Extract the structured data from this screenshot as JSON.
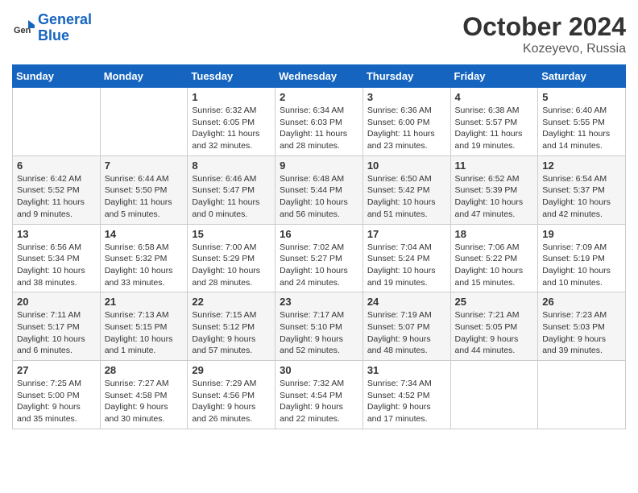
{
  "logo": {
    "line1": "General",
    "line2": "Blue"
  },
  "title": "October 2024",
  "location": "Kozeyevo, Russia",
  "days_of_week": [
    "Sunday",
    "Monday",
    "Tuesday",
    "Wednesday",
    "Thursday",
    "Friday",
    "Saturday"
  ],
  "weeks": [
    [
      {
        "day": "",
        "info": ""
      },
      {
        "day": "",
        "info": ""
      },
      {
        "day": "1",
        "info": "Sunrise: 6:32 AM\nSunset: 6:05 PM\nDaylight: 11 hours and 32 minutes."
      },
      {
        "day": "2",
        "info": "Sunrise: 6:34 AM\nSunset: 6:03 PM\nDaylight: 11 hours and 28 minutes."
      },
      {
        "day": "3",
        "info": "Sunrise: 6:36 AM\nSunset: 6:00 PM\nDaylight: 11 hours and 23 minutes."
      },
      {
        "day": "4",
        "info": "Sunrise: 6:38 AM\nSunset: 5:57 PM\nDaylight: 11 hours and 19 minutes."
      },
      {
        "day": "5",
        "info": "Sunrise: 6:40 AM\nSunset: 5:55 PM\nDaylight: 11 hours and 14 minutes."
      }
    ],
    [
      {
        "day": "6",
        "info": "Sunrise: 6:42 AM\nSunset: 5:52 PM\nDaylight: 11 hours and 9 minutes."
      },
      {
        "day": "7",
        "info": "Sunrise: 6:44 AM\nSunset: 5:50 PM\nDaylight: 11 hours and 5 minutes."
      },
      {
        "day": "8",
        "info": "Sunrise: 6:46 AM\nSunset: 5:47 PM\nDaylight: 11 hours and 0 minutes."
      },
      {
        "day": "9",
        "info": "Sunrise: 6:48 AM\nSunset: 5:44 PM\nDaylight: 10 hours and 56 minutes."
      },
      {
        "day": "10",
        "info": "Sunrise: 6:50 AM\nSunset: 5:42 PM\nDaylight: 10 hours and 51 minutes."
      },
      {
        "day": "11",
        "info": "Sunrise: 6:52 AM\nSunset: 5:39 PM\nDaylight: 10 hours and 47 minutes."
      },
      {
        "day": "12",
        "info": "Sunrise: 6:54 AM\nSunset: 5:37 PM\nDaylight: 10 hours and 42 minutes."
      }
    ],
    [
      {
        "day": "13",
        "info": "Sunrise: 6:56 AM\nSunset: 5:34 PM\nDaylight: 10 hours and 38 minutes."
      },
      {
        "day": "14",
        "info": "Sunrise: 6:58 AM\nSunset: 5:32 PM\nDaylight: 10 hours and 33 minutes."
      },
      {
        "day": "15",
        "info": "Sunrise: 7:00 AM\nSunset: 5:29 PM\nDaylight: 10 hours and 28 minutes."
      },
      {
        "day": "16",
        "info": "Sunrise: 7:02 AM\nSunset: 5:27 PM\nDaylight: 10 hours and 24 minutes."
      },
      {
        "day": "17",
        "info": "Sunrise: 7:04 AM\nSunset: 5:24 PM\nDaylight: 10 hours and 19 minutes."
      },
      {
        "day": "18",
        "info": "Sunrise: 7:06 AM\nSunset: 5:22 PM\nDaylight: 10 hours and 15 minutes."
      },
      {
        "day": "19",
        "info": "Sunrise: 7:09 AM\nSunset: 5:19 PM\nDaylight: 10 hours and 10 minutes."
      }
    ],
    [
      {
        "day": "20",
        "info": "Sunrise: 7:11 AM\nSunset: 5:17 PM\nDaylight: 10 hours and 6 minutes."
      },
      {
        "day": "21",
        "info": "Sunrise: 7:13 AM\nSunset: 5:15 PM\nDaylight: 10 hours and 1 minute."
      },
      {
        "day": "22",
        "info": "Sunrise: 7:15 AM\nSunset: 5:12 PM\nDaylight: 9 hours and 57 minutes."
      },
      {
        "day": "23",
        "info": "Sunrise: 7:17 AM\nSunset: 5:10 PM\nDaylight: 9 hours and 52 minutes."
      },
      {
        "day": "24",
        "info": "Sunrise: 7:19 AM\nSunset: 5:07 PM\nDaylight: 9 hours and 48 minutes."
      },
      {
        "day": "25",
        "info": "Sunrise: 7:21 AM\nSunset: 5:05 PM\nDaylight: 9 hours and 44 minutes."
      },
      {
        "day": "26",
        "info": "Sunrise: 7:23 AM\nSunset: 5:03 PM\nDaylight: 9 hours and 39 minutes."
      }
    ],
    [
      {
        "day": "27",
        "info": "Sunrise: 7:25 AM\nSunset: 5:00 PM\nDaylight: 9 hours and 35 minutes."
      },
      {
        "day": "28",
        "info": "Sunrise: 7:27 AM\nSunset: 4:58 PM\nDaylight: 9 hours and 30 minutes."
      },
      {
        "day": "29",
        "info": "Sunrise: 7:29 AM\nSunset: 4:56 PM\nDaylight: 9 hours and 26 minutes."
      },
      {
        "day": "30",
        "info": "Sunrise: 7:32 AM\nSunset: 4:54 PM\nDaylight: 9 hours and 22 minutes."
      },
      {
        "day": "31",
        "info": "Sunrise: 7:34 AM\nSunset: 4:52 PM\nDaylight: 9 hours and 17 minutes."
      },
      {
        "day": "",
        "info": ""
      },
      {
        "day": "",
        "info": ""
      }
    ]
  ]
}
